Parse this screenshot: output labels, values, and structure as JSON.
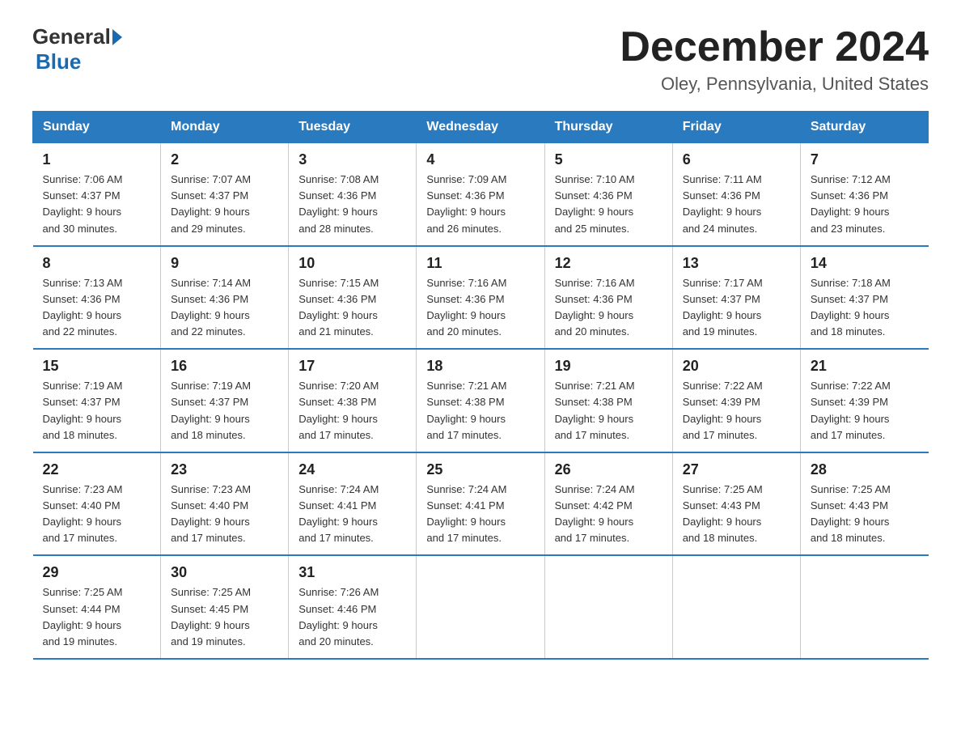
{
  "logo": {
    "general": "General",
    "blue": "Blue"
  },
  "header": {
    "month_title": "December 2024",
    "location": "Oley, Pennsylvania, United States"
  },
  "days_of_week": [
    "Sunday",
    "Monday",
    "Tuesday",
    "Wednesday",
    "Thursday",
    "Friday",
    "Saturday"
  ],
  "weeks": [
    [
      {
        "day": "1",
        "sunrise": "7:06 AM",
        "sunset": "4:37 PM",
        "daylight": "9 hours and 30 minutes."
      },
      {
        "day": "2",
        "sunrise": "7:07 AM",
        "sunset": "4:37 PM",
        "daylight": "9 hours and 29 minutes."
      },
      {
        "day": "3",
        "sunrise": "7:08 AM",
        "sunset": "4:36 PM",
        "daylight": "9 hours and 28 minutes."
      },
      {
        "day": "4",
        "sunrise": "7:09 AM",
        "sunset": "4:36 PM",
        "daylight": "9 hours and 26 minutes."
      },
      {
        "day": "5",
        "sunrise": "7:10 AM",
        "sunset": "4:36 PM",
        "daylight": "9 hours and 25 minutes."
      },
      {
        "day": "6",
        "sunrise": "7:11 AM",
        "sunset": "4:36 PM",
        "daylight": "9 hours and 24 minutes."
      },
      {
        "day": "7",
        "sunrise": "7:12 AM",
        "sunset": "4:36 PM",
        "daylight": "9 hours and 23 minutes."
      }
    ],
    [
      {
        "day": "8",
        "sunrise": "7:13 AM",
        "sunset": "4:36 PM",
        "daylight": "9 hours and 22 minutes."
      },
      {
        "day": "9",
        "sunrise": "7:14 AM",
        "sunset": "4:36 PM",
        "daylight": "9 hours and 22 minutes."
      },
      {
        "day": "10",
        "sunrise": "7:15 AM",
        "sunset": "4:36 PM",
        "daylight": "9 hours and 21 minutes."
      },
      {
        "day": "11",
        "sunrise": "7:16 AM",
        "sunset": "4:36 PM",
        "daylight": "9 hours and 20 minutes."
      },
      {
        "day": "12",
        "sunrise": "7:16 AM",
        "sunset": "4:36 PM",
        "daylight": "9 hours and 20 minutes."
      },
      {
        "day": "13",
        "sunrise": "7:17 AM",
        "sunset": "4:37 PM",
        "daylight": "9 hours and 19 minutes."
      },
      {
        "day": "14",
        "sunrise": "7:18 AM",
        "sunset": "4:37 PM",
        "daylight": "9 hours and 18 minutes."
      }
    ],
    [
      {
        "day": "15",
        "sunrise": "7:19 AM",
        "sunset": "4:37 PM",
        "daylight": "9 hours and 18 minutes."
      },
      {
        "day": "16",
        "sunrise": "7:19 AM",
        "sunset": "4:37 PM",
        "daylight": "9 hours and 18 minutes."
      },
      {
        "day": "17",
        "sunrise": "7:20 AM",
        "sunset": "4:38 PM",
        "daylight": "9 hours and 17 minutes."
      },
      {
        "day": "18",
        "sunrise": "7:21 AM",
        "sunset": "4:38 PM",
        "daylight": "9 hours and 17 minutes."
      },
      {
        "day": "19",
        "sunrise": "7:21 AM",
        "sunset": "4:38 PM",
        "daylight": "9 hours and 17 minutes."
      },
      {
        "day": "20",
        "sunrise": "7:22 AM",
        "sunset": "4:39 PM",
        "daylight": "9 hours and 17 minutes."
      },
      {
        "day": "21",
        "sunrise": "7:22 AM",
        "sunset": "4:39 PM",
        "daylight": "9 hours and 17 minutes."
      }
    ],
    [
      {
        "day": "22",
        "sunrise": "7:23 AM",
        "sunset": "4:40 PM",
        "daylight": "9 hours and 17 minutes."
      },
      {
        "day": "23",
        "sunrise": "7:23 AM",
        "sunset": "4:40 PM",
        "daylight": "9 hours and 17 minutes."
      },
      {
        "day": "24",
        "sunrise": "7:24 AM",
        "sunset": "4:41 PM",
        "daylight": "9 hours and 17 minutes."
      },
      {
        "day": "25",
        "sunrise": "7:24 AM",
        "sunset": "4:41 PM",
        "daylight": "9 hours and 17 minutes."
      },
      {
        "day": "26",
        "sunrise": "7:24 AM",
        "sunset": "4:42 PM",
        "daylight": "9 hours and 17 minutes."
      },
      {
        "day": "27",
        "sunrise": "7:25 AM",
        "sunset": "4:43 PM",
        "daylight": "9 hours and 18 minutes."
      },
      {
        "day": "28",
        "sunrise": "7:25 AM",
        "sunset": "4:43 PM",
        "daylight": "9 hours and 18 minutes."
      }
    ],
    [
      {
        "day": "29",
        "sunrise": "7:25 AM",
        "sunset": "4:44 PM",
        "daylight": "9 hours and 19 minutes."
      },
      {
        "day": "30",
        "sunrise": "7:25 AM",
        "sunset": "4:45 PM",
        "daylight": "9 hours and 19 minutes."
      },
      {
        "day": "31",
        "sunrise": "7:26 AM",
        "sunset": "4:46 PM",
        "daylight": "9 hours and 20 minutes."
      },
      null,
      null,
      null,
      null
    ]
  ],
  "labels": {
    "sunrise": "Sunrise:",
    "sunset": "Sunset:",
    "daylight": "Daylight:"
  }
}
